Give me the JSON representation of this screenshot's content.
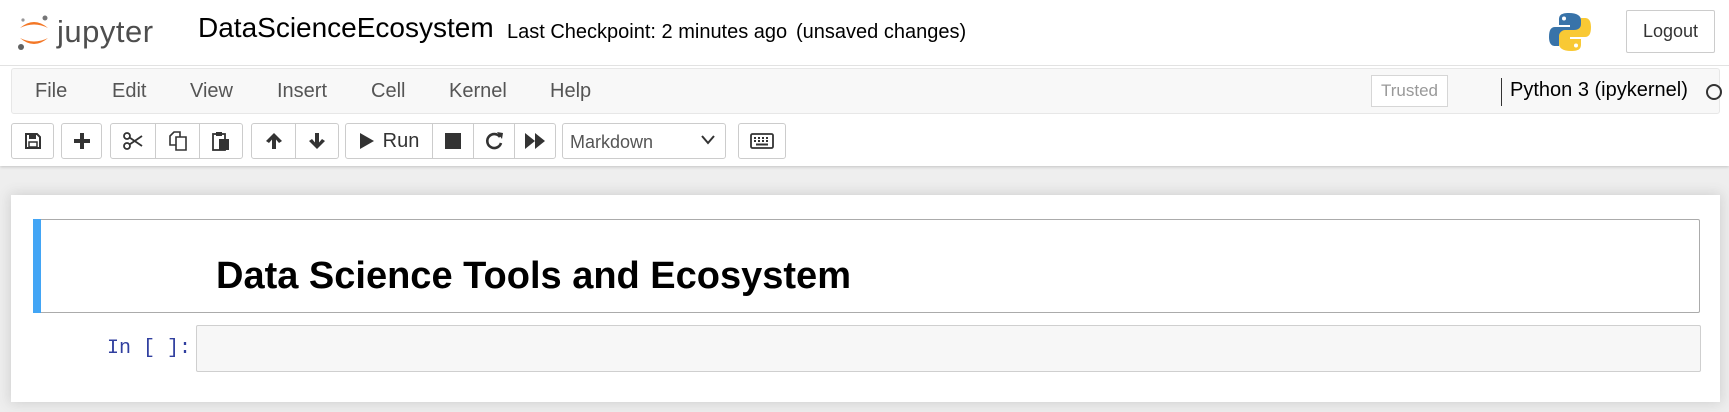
{
  "header": {
    "logo_text": "jupyter",
    "notebook_name": "DataScienceEcosystem",
    "checkpoint": "Last Checkpoint: 2 minutes ago",
    "autosave_status": "(unsaved changes)",
    "logout_label": "Logout",
    "kernel_logo_icon": "python-logo-icon"
  },
  "menubar": {
    "items": [
      "File",
      "Edit",
      "View",
      "Insert",
      "Cell",
      "Kernel",
      "Help"
    ],
    "trusted_label": "Trusted",
    "kernel_name": "Python 3 (ipykernel)",
    "kernel_status_icon": "kernel-idle-circle-icon"
  },
  "toolbar": {
    "icons": [
      "save-icon",
      "plus-icon",
      "scissors-icon",
      "copy-icon",
      "paste-icon",
      "arrow-up-icon",
      "arrow-down-icon",
      "play-icon",
      "stop-icon",
      "restart-icon",
      "fast-forward-icon",
      "keyboard-icon"
    ],
    "run_label": "Run",
    "cell_type": "Markdown"
  },
  "notebook": {
    "markdown_heading": "Data Science Tools and Ecosystem",
    "code_prompt": "In [ ]:",
    "code_input": ""
  },
  "colors": {
    "selected_cell_bar": "#42a5f5",
    "prompt": "#303f9f",
    "logo_orange": "#f37726"
  }
}
